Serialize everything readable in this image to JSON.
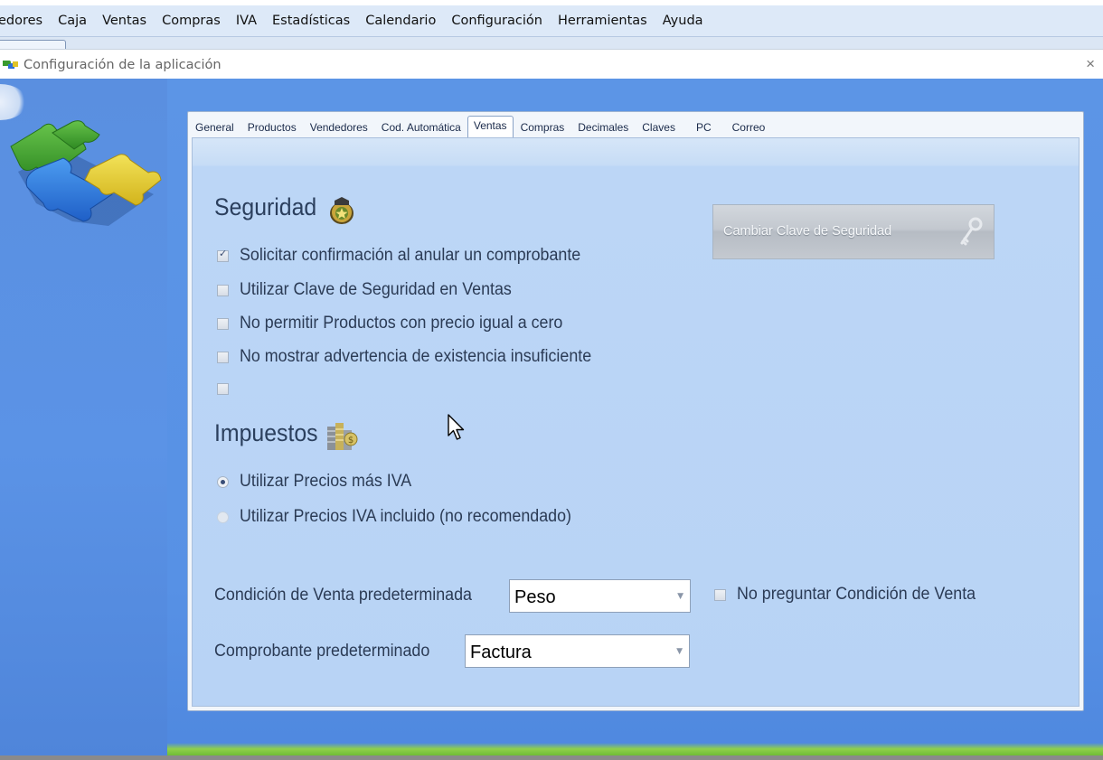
{
  "menubar": {
    "items": [
      "edores",
      "Caja",
      "Ventas",
      "Compras",
      "IVA",
      "Estadísticas",
      "Calendario",
      "Configuración",
      "Herramientas",
      "Ayuda"
    ]
  },
  "window": {
    "title": "Configuración de la aplicación",
    "close_glyph": "×"
  },
  "tabs": [
    {
      "label": "General",
      "active": false
    },
    {
      "label": "Productos",
      "active": false
    },
    {
      "label": "Vendedores",
      "active": false
    },
    {
      "label": "Cod. Automática",
      "active": false
    },
    {
      "label": "Ventas",
      "active": true
    },
    {
      "label": "Compras",
      "active": false
    },
    {
      "label": "Decimales",
      "active": false
    },
    {
      "label": "Claves",
      "active": false
    },
    {
      "label": "PC",
      "active": false
    },
    {
      "label": "Correo",
      "active": false
    }
  ],
  "seguridad": {
    "heading": "Seguridad",
    "icon": "police-badge-icon",
    "options": [
      {
        "label": "Solicitar confirmación al anular un comprobante",
        "checked": true
      },
      {
        "label": "Utilizar Clave de Seguridad en Ventas",
        "checked": false
      },
      {
        "label": "No permitir Productos con precio igual a cero",
        "checked": false
      },
      {
        "label": "No mostrar advertencia de existencia insuficiente",
        "checked": false
      },
      {
        "label": "",
        "checked": false
      }
    ],
    "button_label": "Cambiar Clave de Seguridad",
    "button_icon": "key-icon"
  },
  "impuestos": {
    "heading": "Impuestos",
    "icon": "coins-icon",
    "options": [
      {
        "label": "Utilizar Precios más IVA",
        "selected": true
      },
      {
        "label": "Utilizar Precios IVA incluido (no recomendado)",
        "selected": false
      }
    ]
  },
  "condicion": {
    "label": "Condición de Venta predeterminada",
    "value": "Peso",
    "no_preguntar_label": "No preguntar Condición de Venta",
    "no_preguntar_checked": false
  },
  "comprobante": {
    "label": "Comprobante predeterminado",
    "value": "Factura"
  },
  "colors": {
    "background_blue": "#5791e5",
    "panel_fill": "#b8d3f5",
    "text": "#2b3b55"
  }
}
